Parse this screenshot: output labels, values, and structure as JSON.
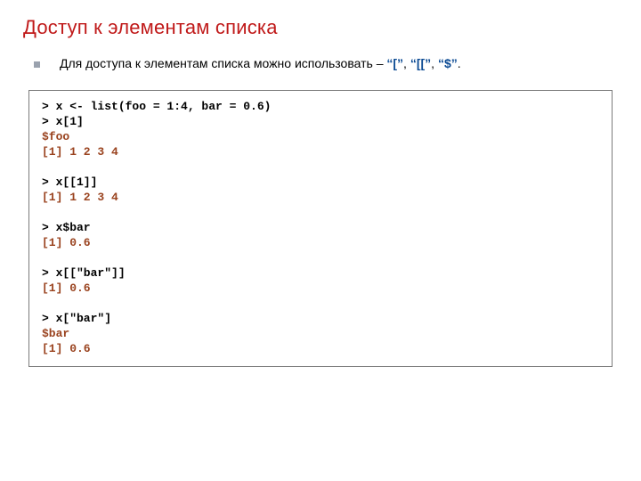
{
  "title": "Доступ к элементам списка",
  "bullet": {
    "pre": "Для доступа к элементам списка можно использовать – ",
    "op1": "“[”",
    "op2": "“[[”",
    "op3": "“$”",
    "sep": ", ",
    "post": "."
  },
  "code": {
    "l1": "> x <- list(foo = 1:4, bar = 0.6)",
    "l2": "> x[1]",
    "l3": "$foo",
    "l4": "[1] 1 2 3 4",
    "l5": "> x[[1]]",
    "l6": "[1] 1 2 3 4",
    "l7": "> x$bar",
    "l8": "[1] 0.6",
    "l9": "> x[[\"bar\"]]",
    "l10": "[1] 0.6",
    "l11": "> x[\"bar\"]",
    "l12": "$bar",
    "l13": "[1] 0.6"
  }
}
